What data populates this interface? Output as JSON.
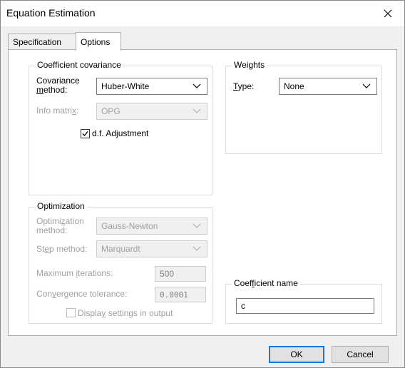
{
  "window": {
    "title": "Equation Estimation"
  },
  "tabs": [
    {
      "label": "Specification",
      "active": false
    },
    {
      "label": "Options",
      "active": true
    }
  ],
  "coef_cov": {
    "title": "Coefficient covariance",
    "cov_method_label_1": "Covariance",
    "cov_method_label_2_pre": "",
    "cov_method_label_2_u": "m",
    "cov_method_label_2_post": "ethod:",
    "cov_method_value": "Huber-White",
    "info_matrix_label_pre": "Info matri",
    "info_matrix_label_u": "x",
    "info_matrix_label_post": ":",
    "info_matrix_value": "OPG",
    "df_adj_label_pre": "d.f. Ad",
    "df_adj_label_u": "j",
    "df_adj_label_post": "ustment",
    "df_adj_checked": true
  },
  "weights": {
    "title": "Weights",
    "type_label_u": "T",
    "type_label_post": "ype:",
    "type_value": "None"
  },
  "optimization": {
    "title": "Optimization",
    "opt_method_label_1_pre": "Optimi",
    "opt_method_label_1_u": "z",
    "opt_method_label_1_post": "ation",
    "opt_method_label_2": "method:",
    "opt_method_value": "Gauss-Newton",
    "step_label_pre": "St",
    "step_label_u": "e",
    "step_label_post": "p method:",
    "step_value": "Marquardt",
    "max_iter_label_pre": "Maximum ",
    "max_iter_label_u": "i",
    "max_iter_label_post": "terations:",
    "max_iter_value": "500",
    "conv_tol_label_pre": "Con",
    "conv_tol_label_u": "v",
    "conv_tol_label_post": "ergence tolerance:",
    "conv_tol_value": "0.0001",
    "display_label_pre": "Displa",
    "display_label_u": "y",
    "display_label_post": " settings in output",
    "display_checked": false
  },
  "coef_name": {
    "title_pre": "Coef",
    "title_u": "f",
    "title_post": "icient name",
    "value": "c"
  },
  "buttons": {
    "ok": "OK",
    "cancel": "Cancel"
  },
  "icons": {
    "close": "close-icon",
    "chevron": "chevron-down-icon",
    "check": "checkmark-icon"
  }
}
